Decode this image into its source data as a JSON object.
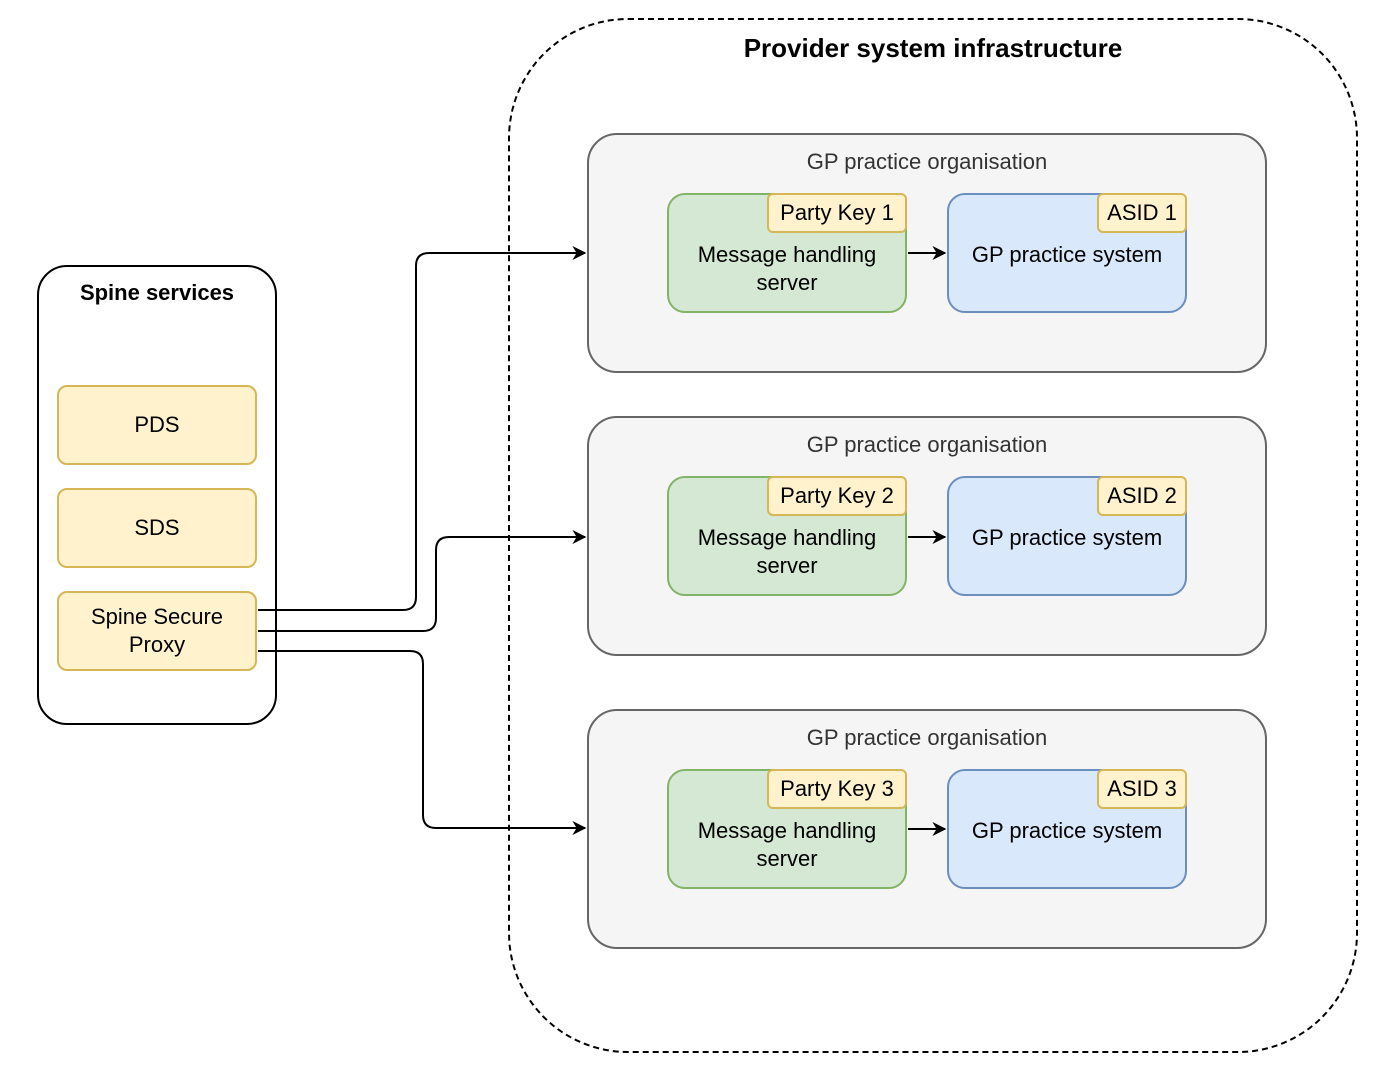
{
  "provider": {
    "title": "Provider system infrastructure"
  },
  "spine": {
    "title": "Spine services",
    "services": [
      {
        "label": "PDS"
      },
      {
        "label": "SDS"
      },
      {
        "label": "Spine Secure Proxy"
      }
    ]
  },
  "organisations": [
    {
      "title": "GP practice organisation",
      "mhs_label": "Message handling server",
      "party_key": "Party Key 1",
      "system_label": "GP practice system",
      "asid": "ASID 1"
    },
    {
      "title": "GP practice organisation",
      "mhs_label": "Message handling server",
      "party_key": "Party Key 2",
      "system_label": "GP practice system",
      "asid": "ASID 2"
    },
    {
      "title": "GP practice organisation",
      "mhs_label": "Message handling server",
      "party_key": "Party Key 3",
      "system_label": "GP practice system",
      "asid": "ASID 3"
    }
  ],
  "colors": {
    "service_fill": "#fff2cc",
    "service_stroke": "#d6b656",
    "mhs_fill": "#d5e8d4",
    "mhs_stroke": "#82b366",
    "system_fill": "#dae8fc",
    "system_stroke": "#6c8ebf",
    "org_fill": "#f5f5f5",
    "org_stroke": "#666666"
  }
}
